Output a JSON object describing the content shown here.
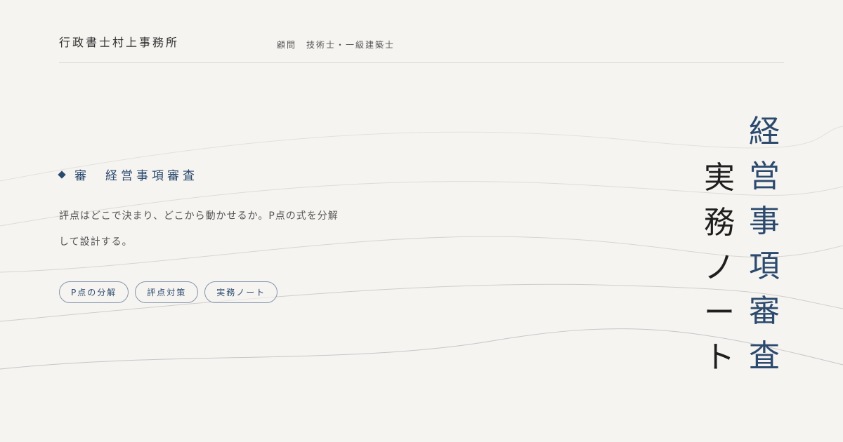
{
  "header": {
    "office_name": "行政書士村上事務所",
    "advisor": "顧問　技術士・一級建築士"
  },
  "section": {
    "label": "審　経営事項審査"
  },
  "description": {
    "line1": "評点はどこで決まり、どこから動かせるか。P点の式を分解",
    "line2": "して設計する。"
  },
  "tags": [
    "P点の分解",
    "評点対策",
    "実務ノート"
  ],
  "vertical_title": {
    "main": [
      "経",
      "営",
      "事",
      "項",
      "審",
      "査"
    ],
    "sub": [
      "実",
      "務",
      "ノ",
      "ー",
      "ト"
    ]
  },
  "colors": {
    "background": "#f6f4f1",
    "accent": "#2c4a6e",
    "text": "#333333"
  }
}
